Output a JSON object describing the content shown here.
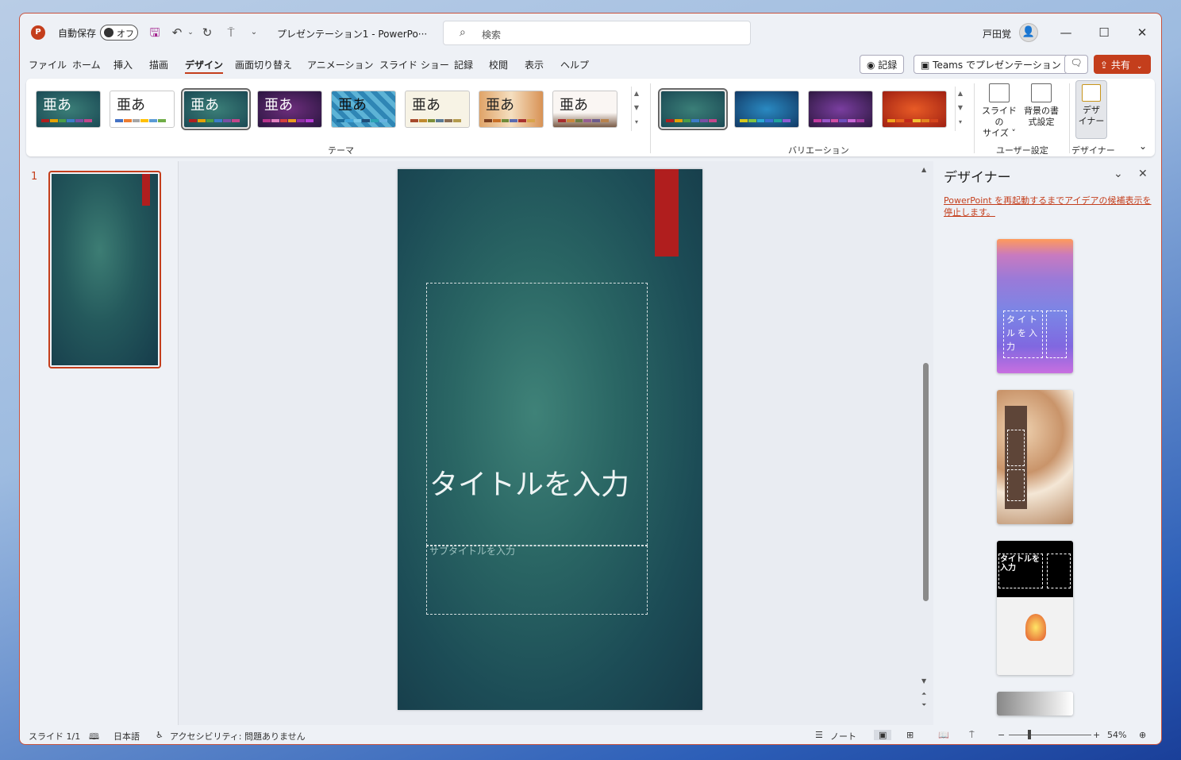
{
  "titlebar": {
    "app_logo": "P",
    "autosave_label": "自動保存",
    "autosave_state": "オフ",
    "doc_title": "プレゼンテーション1 - PowerPo···",
    "search_placeholder": "検索",
    "user_name": "戸田覚"
  },
  "menu": {
    "tabs": [
      "ファイル",
      "ホーム",
      "挿入",
      "描画",
      "デザイン",
      "画面切り替え",
      "アニメーション",
      "スライド ショー",
      "記録",
      "校閲",
      "表示",
      "ヘルプ"
    ],
    "active_tab": "デザイン",
    "record_label": "記録",
    "teams_label": "Teams でプレゼンテーション",
    "share_label": "共有"
  },
  "ribbon": {
    "themes_label": "テーマ",
    "variations_label": "バリエーション",
    "customize_label": "ユーザー設定",
    "designer_group_label": "デザイナー",
    "theme_text": "亜あ",
    "slide_size_label": "スライドの\nサイズ ˅",
    "bg_format_label": "背景の書\n式設定",
    "designer_btn_label": "デザ\nイナー"
  },
  "thumbs": {
    "slide_number": "1"
  },
  "slide": {
    "title": "タイトルを入力",
    "subtitle": "サブタイトルを入力"
  },
  "designer": {
    "header": "デザイナー",
    "notice": "PowerPoint を再起動するまでアイデアの候補表示を停止します。",
    "idea1_title": "タイトルを入力",
    "idea3_title": "タイトルを入力"
  },
  "status": {
    "slide_count": "スライド 1/1",
    "language": "日本語",
    "accessibility": "アクセシビリティ: 問題ありません",
    "notes": "ノート",
    "zoom": "54%"
  },
  "colors": {
    "accent": "#c43e1c",
    "slide_bg": "#24595c",
    "slide_ribbon": "#b01e1e"
  }
}
